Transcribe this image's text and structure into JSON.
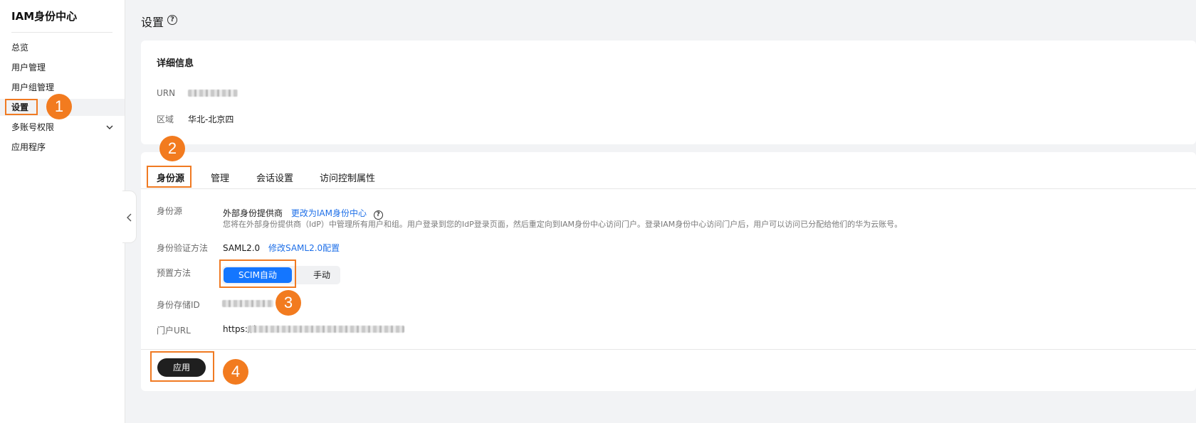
{
  "sidebar": {
    "title": "IAM身份中心",
    "items": [
      {
        "label": "总览"
      },
      {
        "label": "用户管理"
      },
      {
        "label": "用户组管理"
      },
      {
        "label": "设置"
      },
      {
        "label": "多账号权限"
      },
      {
        "label": "应用程序"
      }
    ]
  },
  "page": {
    "title": "设置",
    "help_glyph": "?"
  },
  "details": {
    "title": "详细信息",
    "urn_label": "URN",
    "region_label": "区域",
    "region_value": "华北-北京四"
  },
  "tabs": [
    {
      "label": "身份源"
    },
    {
      "label": "管理"
    },
    {
      "label": "会话设置"
    },
    {
      "label": "访问控制属性"
    }
  ],
  "identity_source": {
    "label": "身份源",
    "value": "外部身份提供商",
    "change_link": "更改为IAM身份中心",
    "help_glyph": "?",
    "description": "您将在外部身份提供商（IdP）中管理所有用户和组。用户登录到您的IdP登录页面，然后重定向到IAM身份中心访问门户。登录IAM身份中心访问门户后，用户可以访问已分配给他们的华为云账号。"
  },
  "auth_method": {
    "label": "身份验证方法",
    "value": "SAML2.0",
    "modify_link": "修改SAML2.0配置"
  },
  "provisioning": {
    "label": "预置方法",
    "options": [
      "SCIM自动",
      "手动"
    ]
  },
  "store_id": {
    "label": "身份存储ID"
  },
  "portal_url": {
    "label": "门户URL",
    "value_prefix": "https://i"
  },
  "apply_button": "应用",
  "badges": [
    "1",
    "2",
    "3",
    "4"
  ],
  "accent_colors": {
    "primary": "#1476ff",
    "annotation": "#f27b1f"
  }
}
